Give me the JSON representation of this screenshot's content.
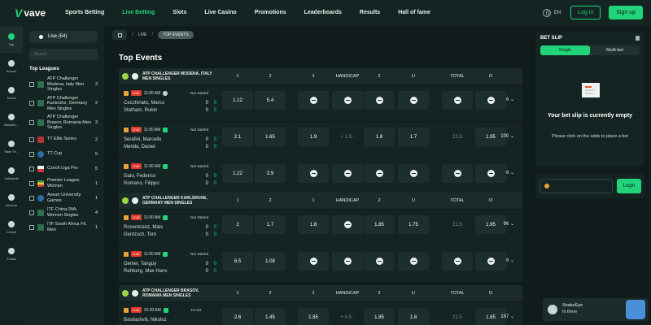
{
  "brand": {
    "mark": "V",
    "name": "vave"
  },
  "nav": [
    "Sports Betting",
    "Live Betting",
    "Slots",
    "Live Casino",
    "Promotions",
    "Leaderboards",
    "Results",
    "Hall of fame"
  ],
  "nav_active": "Live Betting",
  "lang": "EN",
  "login_label": "Log in",
  "signup_label": "Sign up",
  "rail": [
    {
      "label": "Top",
      "active": true
    },
    {
      "label": "Soccer"
    },
    {
      "label": "Tennis"
    },
    {
      "label": "Basketb..."
    },
    {
      "label": "Table Te..."
    },
    {
      "label": "Volleyball"
    },
    {
      "label": "eSoccer"
    },
    {
      "label": "Cricket"
    },
    {
      "label": "Futsal"
    }
  ],
  "sidebar": {
    "live_label": "Live (54)",
    "search_placeholder": "Search",
    "leagues_title": "Top Leagues",
    "leagues": [
      {
        "name": "ATP Challenger Modena, Italy Men Singles",
        "count": "3"
      },
      {
        "name": "ATP Challenger Karlsruhe, Germany Men Singles",
        "count": "2"
      },
      {
        "name": "ATP Challenger Brasov, Romania Men Singles",
        "count": "3"
      },
      {
        "name": "TT Elite Series",
        "count": "2"
      },
      {
        "name": "TT Cup",
        "count": "5"
      },
      {
        "name": "Czech Liga Pro",
        "count": "5"
      },
      {
        "name": "Premier League, Women",
        "count": "1"
      },
      {
        "name": "Asean University Games",
        "count": "1"
      },
      {
        "name": "ITF China 09A, Women Singles",
        "count": "4"
      },
      {
        "name": "ITF South Africa F6, Men",
        "count": "1"
      }
    ]
  },
  "breadcrumb": {
    "live": "LIVE",
    "current": "TOP EVENTS"
  },
  "page_title": "Top Events",
  "columns": [
    "1",
    "2",
    "1",
    "HANDICAP",
    "2",
    "U",
    "TOTAL",
    "O"
  ],
  "blocks": [
    {
      "title": "ATP CHALLENGER MODENA, ITALY MEN SINGLES",
      "matches": [
        {
          "time": "11:00 AM",
          "status": "Not started",
          "home": "Cecchinato, Marco",
          "away": "Statham, Rubin",
          "home_score": [
            "0",
            "0"
          ],
          "away_score": [
            "0",
            "0"
          ],
          "odds": [
            "1.12",
            "5.4",
            "",
            "",
            "",
            "",
            "",
            ""
          ],
          "more": "6"
        },
        {
          "time": "11:00 AM",
          "status": "Not started",
          "home": "Serafini, Marcello",
          "away": "Merida, Daniel",
          "home_score": [
            "0",
            "0"
          ],
          "away_score": [
            "0",
            "0"
          ],
          "odds": [
            "2.1",
            "1.65",
            "1.9",
            "+ 1.5 -",
            "1.8",
            "1.7",
            "22.5",
            "1.95"
          ],
          "more": "100"
        },
        {
          "time": "11:00 AM",
          "status": "Not started",
          "home": "Galo, Federico",
          "away": "Romano, Filippo",
          "home_score": [
            "0",
            "0"
          ],
          "away_score": [
            "0",
            "0"
          ],
          "odds": [
            "1.22",
            "3.9",
            "",
            "",
            "",
            "",
            "",
            ""
          ],
          "more": "6"
        }
      ]
    },
    {
      "title": "ATP CHALLENGER KARLSRUHE, GERMANY MEN SINGLES",
      "matches": [
        {
          "time": "11:00 AM",
          "status": "Not started",
          "home": "Rosenkranz, Mats",
          "away": "Gentzsch, Tom",
          "home_score": [
            "0",
            "0"
          ],
          "away_score": [
            "0",
            "0"
          ],
          "odds": [
            "2",
            "1.7",
            "1.8",
            "",
            "1.85",
            "1.75",
            "22.5",
            "1.95"
          ],
          "more": "96"
        },
        {
          "time": "11:00 AM",
          "status": "Not started",
          "home": "Genier, Tanguy",
          "away": "Rehberg, Max Hans",
          "home_score": [
            "0",
            "0"
          ],
          "away_score": [
            "0",
            "0"
          ],
          "odds": [
            "6.5",
            "1.08",
            "",
            "",
            "",
            "",
            "",
            ""
          ],
          "more": "6"
        }
      ]
    },
    {
      "title": "ATP CHALLENGER BRASOV, ROMANIA MEN SINGLES",
      "matches": [
        {
          "time": "10:30 AM",
          "status": "1st set",
          "home": "Basilashvili, Nikoloz",
          "away": "",
          "home_score": [
            "",
            ""
          ],
          "away_score": [
            "",
            ""
          ],
          "odds": [
            "2.6",
            "1.45",
            "1.85",
            "+ 4.5 -",
            "1.85",
            "1.8",
            "21.5",
            "1.85"
          ],
          "more": "167"
        }
      ]
    }
  ],
  "betslip": {
    "title": "BET SLIP",
    "tab_single": "Single",
    "tab_multi": "Multi bet",
    "empty_title": "Your bet slip is currently empty",
    "empty_hint": "Please click on the odds to place a bet",
    "login_btn": "Login"
  },
  "chat": {
    "name": "SnakeEye",
    "message": "hi there"
  },
  "colors": {
    "accent": "#21d47a",
    "bg": "#0f1c1b",
    "panel": "#142422",
    "live": "#e0382f"
  }
}
